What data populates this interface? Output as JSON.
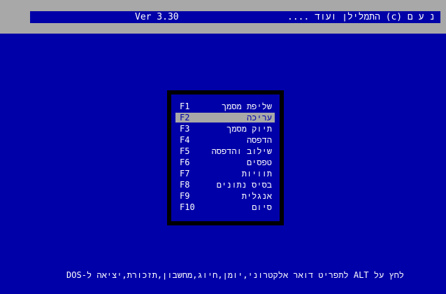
{
  "title_bar": {
    "version": "Ver 3.30",
    "app_title": "נ ע ם (c) התמלילן ועוד ...."
  },
  "menu": {
    "selected_index": 1,
    "items": [
      {
        "key": "F1",
        "label": "שליפת מסמך"
      },
      {
        "key": "F2",
        "label": "עריכה"
      },
      {
        "key": "F3",
        "label": "תיוק מסמך"
      },
      {
        "key": "F4",
        "label": "הדפסה"
      },
      {
        "key": "F5",
        "label": "שילוב והדפסה"
      },
      {
        "key": "F6",
        "label": "טפסים"
      },
      {
        "key": "F7",
        "label": "תוויות"
      },
      {
        "key": "F8",
        "label": "בסיס נתונים"
      },
      {
        "key": "F9",
        "label": "אנגלית"
      },
      {
        "key": "F10",
        "label": "סיום"
      }
    ]
  },
  "status_line": "לחץ על ALT לתפריט דואר אלקטרוני,יומן,חיוג,מחשבון,תזכורת,יציאה ל-DOS"
}
